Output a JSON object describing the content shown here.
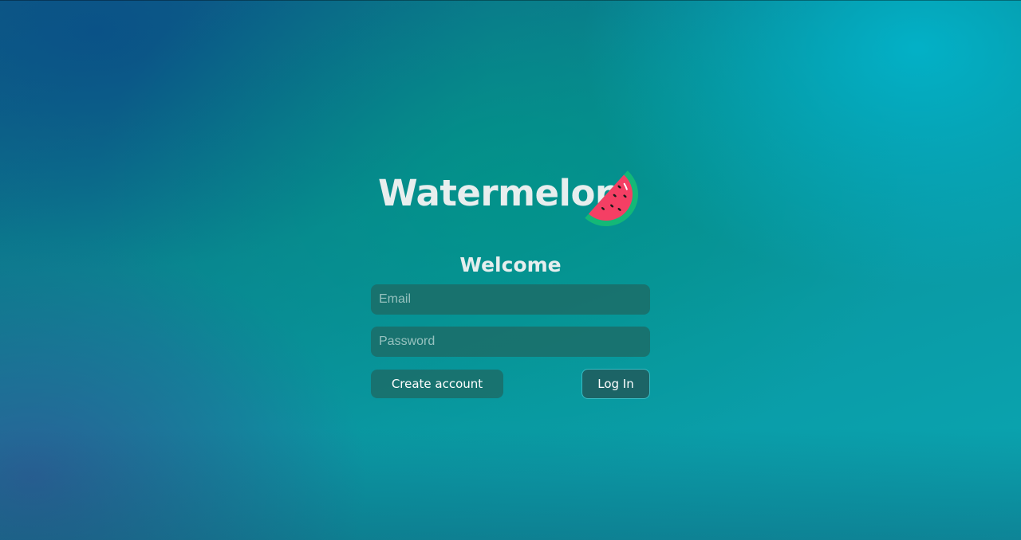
{
  "brand": {
    "name": "Watermelon",
    "icon": "watermelon-slice-icon",
    "colors": {
      "rind": "#14b877",
      "flesh": "#f43f64",
      "seeds": "#1a1a1a",
      "highlight": "#ffffff"
    }
  },
  "login": {
    "heading": "Welcome",
    "email_placeholder": "Email",
    "email_value": "",
    "password_placeholder": "Password",
    "password_value": "",
    "create_account_label": "Create account",
    "login_label": "Log In"
  },
  "theme": {
    "input_bg": "#1e6964",
    "login_button_bg": "#1c6466",
    "login_button_border": "#38bcc4",
    "text": "#e6eeee"
  }
}
